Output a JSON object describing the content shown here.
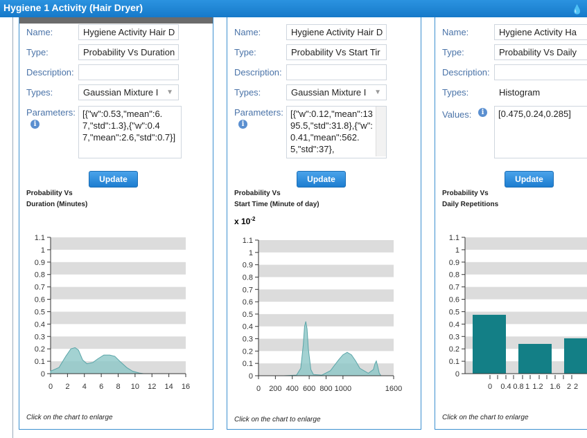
{
  "window": {
    "title": "Hygiene 1 Activity (Hair Dryer)",
    "icon": "water-drop-icon"
  },
  "labels": {
    "name": "Name:",
    "type": "Type:",
    "description": "Description:",
    "types": "Types:",
    "parameters": "Parameters:",
    "values": "Values:",
    "update": "Update",
    "note": "Click on the chart to enlarge"
  },
  "panels": [
    {
      "name": "Hygiene Activity Hair D",
      "type": "Probability Vs Duration",
      "description": "",
      "types": "Gaussian Mixture I",
      "parameters": "[{\"w\":0.53,\"mean\":6.7,\"std\":1.3},{\"w\":0.47,\"mean\":2.6,\"std\":0.7}]",
      "chart_title_1": "Probability Vs",
      "chart_title_2": "Duration (Minutes)"
    },
    {
      "name": "Hygiene Activity Hair D",
      "type": "Probability Vs Start Tir",
      "description": "",
      "types": "Gaussian Mixture I",
      "parameters": "[{\"w\":0.12,\"mean\":1395.5,\"std\":31.8},{\"w\":0.41,\"mean\":562.5,\"std\":37},",
      "chart_title_1": "Probability Vs",
      "chart_title_2": "Start Time (Minute of day)",
      "exponent": "x 10",
      "exponent_power": "-2"
    },
    {
      "name": "Hygiene Activity Ha",
      "type": "Probability Vs Daily",
      "description": "",
      "types": "Histogram",
      "values": "[0.475,0.24,0.285]",
      "chart_title_1": "Probability Vs",
      "chart_title_2": "Daily Repetitions"
    }
  ],
  "colors": {
    "header": "#1e84d2",
    "fill": "#8cc7c7",
    "line": "#5aa5a8",
    "bar": "#137f86",
    "band": "#dcdcdc"
  },
  "chart_data": [
    {
      "type": "area",
      "xlabel": "",
      "ylabel": "",
      "xlim": [
        0,
        16
      ],
      "ylim": [
        0,
        1.1
      ],
      "xticks": [
        0,
        2,
        4,
        6,
        8,
        10,
        12,
        14,
        16
      ],
      "yticks": [
        0,
        0.1,
        0.2,
        0.3,
        0.4,
        0.5,
        0.6,
        0.7,
        0.8,
        0.9,
        1,
        1.1
      ],
      "x": [
        0,
        1,
        1.8,
        2.4,
        2.9,
        3.3,
        3.8,
        4.3,
        5,
        5.6,
        6.3,
        7,
        7.6,
        8.2,
        9,
        9.7,
        10.5,
        11,
        16
      ],
      "y": [
        0.02,
        0.05,
        0.14,
        0.2,
        0.21,
        0.19,
        0.11,
        0.08,
        0.09,
        0.12,
        0.15,
        0.15,
        0.14,
        0.1,
        0.05,
        0.02,
        0.005,
        0,
        0
      ]
    },
    {
      "type": "area",
      "xlabel": "",
      "ylabel": "",
      "ylim": [
        0,
        1.1
      ],
      "xlim": [
        0,
        1600
      ],
      "xticks": [
        0,
        200,
        400,
        600,
        800,
        1000,
        1600
      ],
      "yticks": [
        0,
        0.1,
        0.2,
        0.3,
        0.4,
        0.5,
        0.6,
        0.7,
        0.8,
        0.9,
        1,
        1.1
      ],
      "x": [
        0,
        300,
        450,
        500,
        530,
        545,
        560,
        575,
        590,
        620,
        650,
        750,
        850,
        950,
        1000,
        1050,
        1100,
        1150,
        1200,
        1300,
        1360,
        1380,
        1395,
        1410,
        1430,
        1450
      ],
      "y": [
        0,
        0,
        0.005,
        0.06,
        0.25,
        0.4,
        0.44,
        0.38,
        0.22,
        0.05,
        0.01,
        0.005,
        0.04,
        0.13,
        0.17,
        0.19,
        0.17,
        0.12,
        0.06,
        0.02,
        0.05,
        0.1,
        0.12,
        0.08,
        0.02,
        0
      ]
    },
    {
      "type": "bar",
      "xlabel": "",
      "ylabel": "",
      "ylim": [
        0,
        1.1
      ],
      "xtick_labels": [
        "0",
        "0.4",
        "0.8",
        "1",
        "1.2",
        "1.6",
        "2",
        "2"
      ],
      "yticks": [
        0,
        0.1,
        0.2,
        0.3,
        0.4,
        0.5,
        0.6,
        0.7,
        0.8,
        0.9,
        1,
        1.1
      ],
      "values": [
        0.475,
        0.24,
        0.285
      ]
    }
  ]
}
